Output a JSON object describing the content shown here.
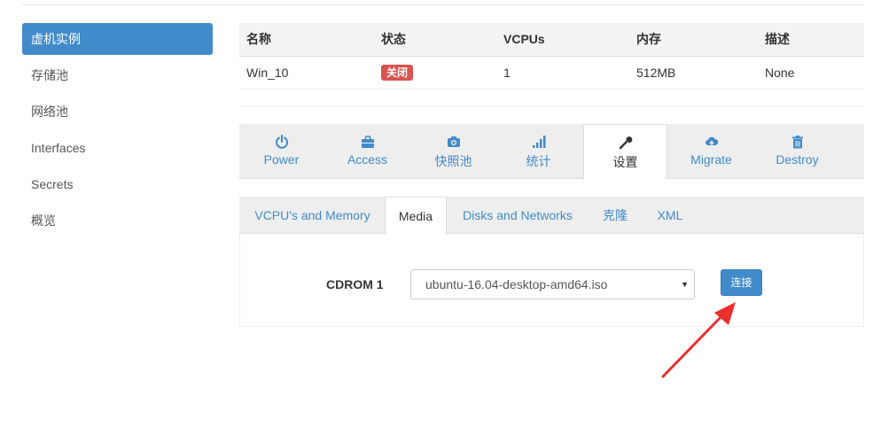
{
  "sidebar": {
    "items": [
      {
        "label": "虚机实例",
        "active": true
      },
      {
        "label": "存储池"
      },
      {
        "label": "网络池"
      },
      {
        "label": "Interfaces"
      },
      {
        "label": "Secrets"
      },
      {
        "label": "概览"
      }
    ]
  },
  "table": {
    "headers": [
      "名称",
      "状态",
      "VCPUs",
      "内存",
      "描述"
    ],
    "row": {
      "name": "Win_10",
      "status": "关闭",
      "vcpus": "1",
      "memory": "512MB",
      "description": "None"
    }
  },
  "action_tabs": [
    {
      "label": "Power",
      "icon": "power-icon"
    },
    {
      "label": "Access",
      "icon": "briefcase-icon"
    },
    {
      "label": "快照池",
      "icon": "camera-icon"
    },
    {
      "label": "统计",
      "icon": "signal-icon"
    },
    {
      "label": "设置",
      "icon": "wrench-icon",
      "active": true
    },
    {
      "label": "Migrate",
      "icon": "cloud-upload-icon"
    },
    {
      "label": "Destroy",
      "icon": "trash-icon"
    }
  ],
  "sub_tabs": [
    {
      "label": "VCPU's and Memory"
    },
    {
      "label": "Media",
      "active": true
    },
    {
      "label": "Disks and Networks"
    },
    {
      "label": "克隆"
    },
    {
      "label": "XML"
    }
  ],
  "media": {
    "cdrom_label": "CDROM 1",
    "selected_iso": "ubuntu-16.04-desktop-amd64.iso",
    "connect_label": "连接"
  },
  "colors": {
    "accent": "#428bca",
    "danger": "#d9534f",
    "annotation_arrow": "#e8312f"
  }
}
